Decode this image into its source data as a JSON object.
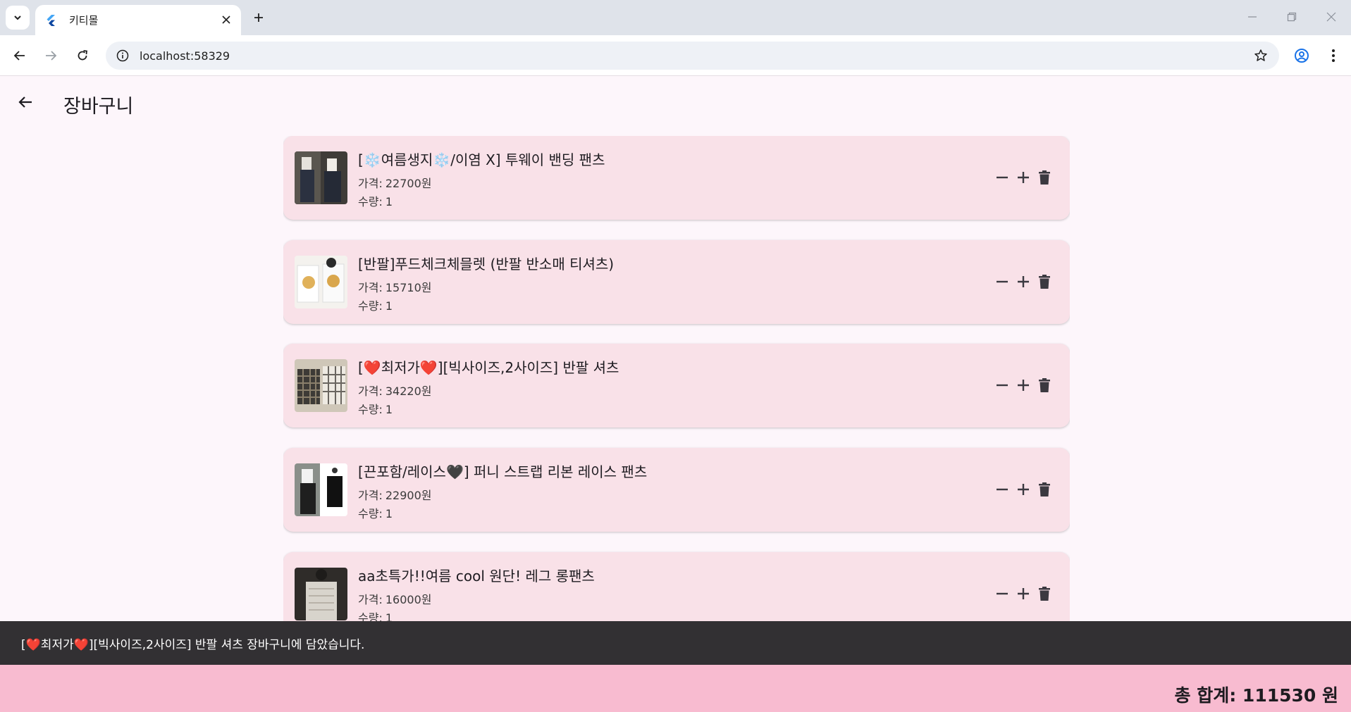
{
  "browser": {
    "tab_title": "키티몰",
    "url": "localhost:58329"
  },
  "app": {
    "title": "장바구니"
  },
  "labels": {
    "price_prefix": "가격:",
    "qty_prefix": "수량:"
  },
  "cart_items": [
    {
      "name": "[❄️여름생지❄️/이염 X] 투웨이 밴딩 팬츠",
      "price": "22700원",
      "qty": "1"
    },
    {
      "name": "[반팔]푸드체크체믈렛 (반팔 반소매 티셔츠)",
      "price": "15710원",
      "qty": "1"
    },
    {
      "name": "[❤️최저가❤️][빅사이즈,2사이즈] 반팔 셔츠",
      "price": "34220원",
      "qty": "1"
    },
    {
      "name": "[끈포함/레이스🖤] 퍼니 스트랩 리본 레이스 팬츠",
      "price": "22900원",
      "qty": "1"
    },
    {
      "name": "aa초특가!!여름 cool 원단! 레그 롱팬츠",
      "price": "16000원",
      "qty": "1"
    }
  ],
  "snackbar": {
    "message": "[❤️최저가❤️][빅사이즈,2사이즈] 반팔 셔츠 장바구니에 담았습니다."
  },
  "total": {
    "text": "총 합계: 111530 원"
  },
  "icons": {
    "back": "arrow-left-icon",
    "decrease": "minus-icon",
    "increase": "plus-icon",
    "delete": "trash-icon"
  },
  "colors": {
    "page_bg": "#fdf6fb",
    "card_bg": "#f9e1e8",
    "total_bar": "#f8bbd0",
    "snackbar": "#323033"
  }
}
